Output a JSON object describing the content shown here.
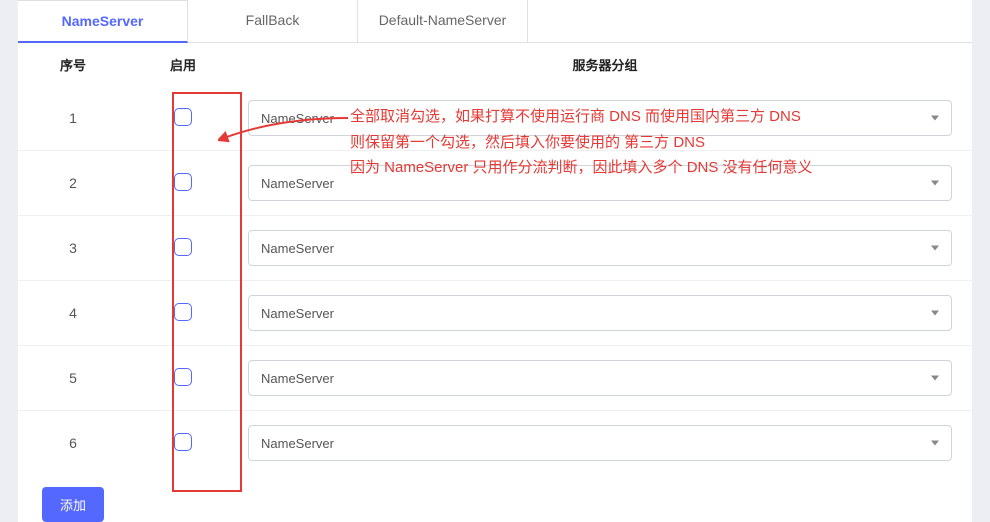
{
  "tabs": [
    {
      "label": "NameServer",
      "active": true
    },
    {
      "label": "FallBack",
      "active": false
    },
    {
      "label": "Default-NameServer",
      "active": false
    }
  ],
  "headers": {
    "index": "序号",
    "enable": "启用",
    "group": "服务器分组"
  },
  "rows": [
    {
      "index": "1",
      "group": "NameServer"
    },
    {
      "index": "2",
      "group": "NameServer"
    },
    {
      "index": "3",
      "group": "NameServer"
    },
    {
      "index": "4",
      "group": "NameServer"
    },
    {
      "index": "5",
      "group": "NameServer"
    },
    {
      "index": "6",
      "group": "NameServer"
    }
  ],
  "annotation": {
    "line1": "全部取消勾选，如果打算不使用运行商 DNS 而使用国内第三方 DNS",
    "line2": "则保留第一个勾选，然后填入你要使用的 第三方 DNS",
    "line3": "因为 NameServer 只用作分流判断，因此填入多个 DNS 没有任何意义"
  },
  "addButton": "添加"
}
